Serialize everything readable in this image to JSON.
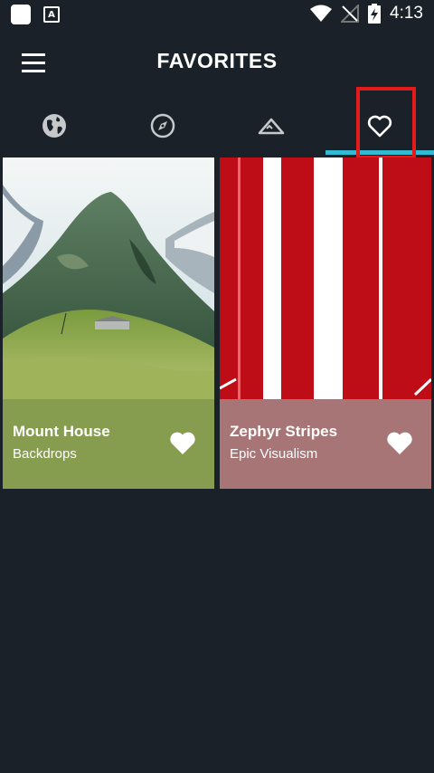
{
  "status_bar": {
    "time": "4:13"
  },
  "app_bar": {
    "title": "FAVORITES"
  },
  "tabs": [
    {
      "name": "World",
      "icon": "globe-icon"
    },
    {
      "name": "Explore",
      "icon": "compass-icon"
    },
    {
      "name": "Landscapes",
      "icon": "mountain-icon"
    },
    {
      "name": "Favorites",
      "icon": "heart-outline-icon",
      "selected": true
    }
  ],
  "colors": {
    "background": "#1b2128",
    "accent": "#33b9d2",
    "highlight": "#e41b1b",
    "card1_info": "#869d4f",
    "card2_info": "#a87577"
  },
  "cards": [
    {
      "title": "Mount House",
      "subtitle": "Backdrops",
      "image": "mountain-landscape"
    },
    {
      "title": "Zephyr Stripes",
      "subtitle": "Epic Visualism",
      "image": "red-white-stripes"
    }
  ]
}
